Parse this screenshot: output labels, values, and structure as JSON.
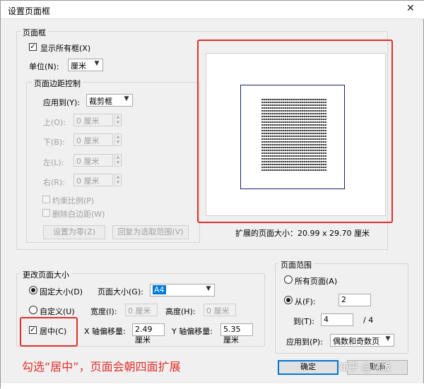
{
  "dialog": {
    "title": "设置页面框"
  },
  "page_boxes": {
    "legend": "页面框",
    "show_all_boxes": {
      "label": "显示所有框(X)",
      "checked": true
    },
    "unit": {
      "label": "单位(N):",
      "value": "厘米"
    }
  },
  "margin_control": {
    "legend": "页面边距控制",
    "apply_to": {
      "label": "应用到(Y):",
      "value": "裁剪框"
    },
    "top": {
      "label": "上(O):",
      "value": "0 厘米"
    },
    "bottom": {
      "label": "下(B):",
      "value": "0 厘米"
    },
    "left": {
      "label": "左(L):",
      "value": "0 厘米"
    },
    "right": {
      "label": "右(R):",
      "value": "0 厘米"
    },
    "constrain": {
      "label": "约束比例(P)"
    },
    "remove_white": {
      "label": "删除白边距(W)"
    },
    "set_zero_button": "设置为零(Z)",
    "revert_button": "回复为选取范围(V)"
  },
  "preview": {
    "size_text": "扩展的页面大小：20.99 x 29.70 厘米"
  },
  "change_size": {
    "legend": "更改页面大小",
    "fixed": {
      "label": "固定大小(D)",
      "selected": true
    },
    "page_size": {
      "label": "页面大小(G):",
      "value": "A4"
    },
    "custom": {
      "label": "自定义(U)",
      "selected": false
    },
    "width": {
      "label": "宽度(I):",
      "value": "0 厘米"
    },
    "height": {
      "label": "高度(H):",
      "value": "0 厘米"
    },
    "center": {
      "label": "居中(C)",
      "checked": true
    },
    "x_offset": {
      "label": "X 轴偏移量:",
      "value": "2.49 厘米"
    },
    "y_offset": {
      "label": "Y 轴偏移量:",
      "value": "5.35 厘米"
    }
  },
  "page_range": {
    "legend": "页面范围",
    "all_pages": {
      "label": "所有页面(A)",
      "selected": false
    },
    "from": {
      "label": "从(F):",
      "value": "2",
      "selected": true
    },
    "to": {
      "label": "到(T):",
      "value": "4",
      "total": "/ 4"
    },
    "apply_to": {
      "label": "应用到(P):",
      "value": "偶数和奇数页"
    }
  },
  "buttons": {
    "ok": "确定",
    "cancel": "取消"
  },
  "annotation": {
    "text": "勾选“居中”，页面会朝四面扩展",
    "color": "#e0302a"
  },
  "watermark": "知乎 @乌饭"
}
